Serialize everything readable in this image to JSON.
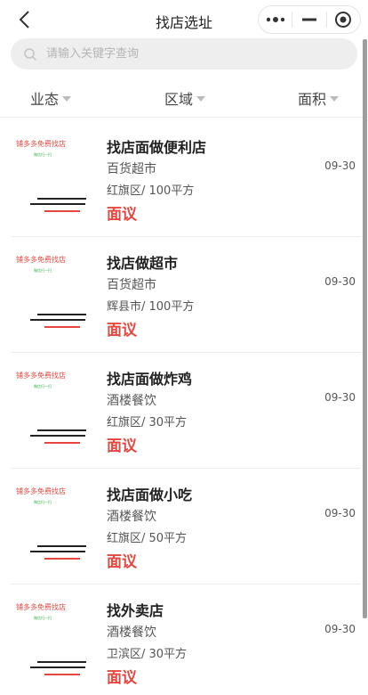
{
  "nav": {
    "title": "找店选址"
  },
  "search": {
    "placeholder": "请输入关键字查询",
    "value": ""
  },
  "filters": [
    {
      "label": "业态"
    },
    {
      "label": "区域"
    },
    {
      "label": "面积"
    }
  ],
  "thumb": {
    "title": "铺多多免费找店",
    "subtitle": "微信扫一扫"
  },
  "listings": [
    {
      "title": "找店面做便利店",
      "category": "百货超市",
      "date": "09-30",
      "location": "红旗区/ 100平方",
      "price": "面议"
    },
    {
      "title": "找店做超市",
      "category": "百货超市",
      "date": "09-30",
      "location": "辉县市/ 100平方",
      "price": "面议"
    },
    {
      "title": "找店面做炸鸡",
      "category": "酒楼餐饮",
      "date": "09-30",
      "location": "红旗区/ 30平方",
      "price": "面议"
    },
    {
      "title": "找店面做小吃",
      "category": "酒楼餐饮",
      "date": "09-30",
      "location": "红旗区/ 50平方",
      "price": "面议"
    },
    {
      "title": "找外卖店",
      "category": "酒楼餐饮",
      "date": "09-30",
      "location": "卫滨区/ 30平方",
      "price": "面议"
    }
  ],
  "colors": {
    "accent": "#e8453c",
    "search_bg": "#eeeeee",
    "divider": "#ededed"
  }
}
